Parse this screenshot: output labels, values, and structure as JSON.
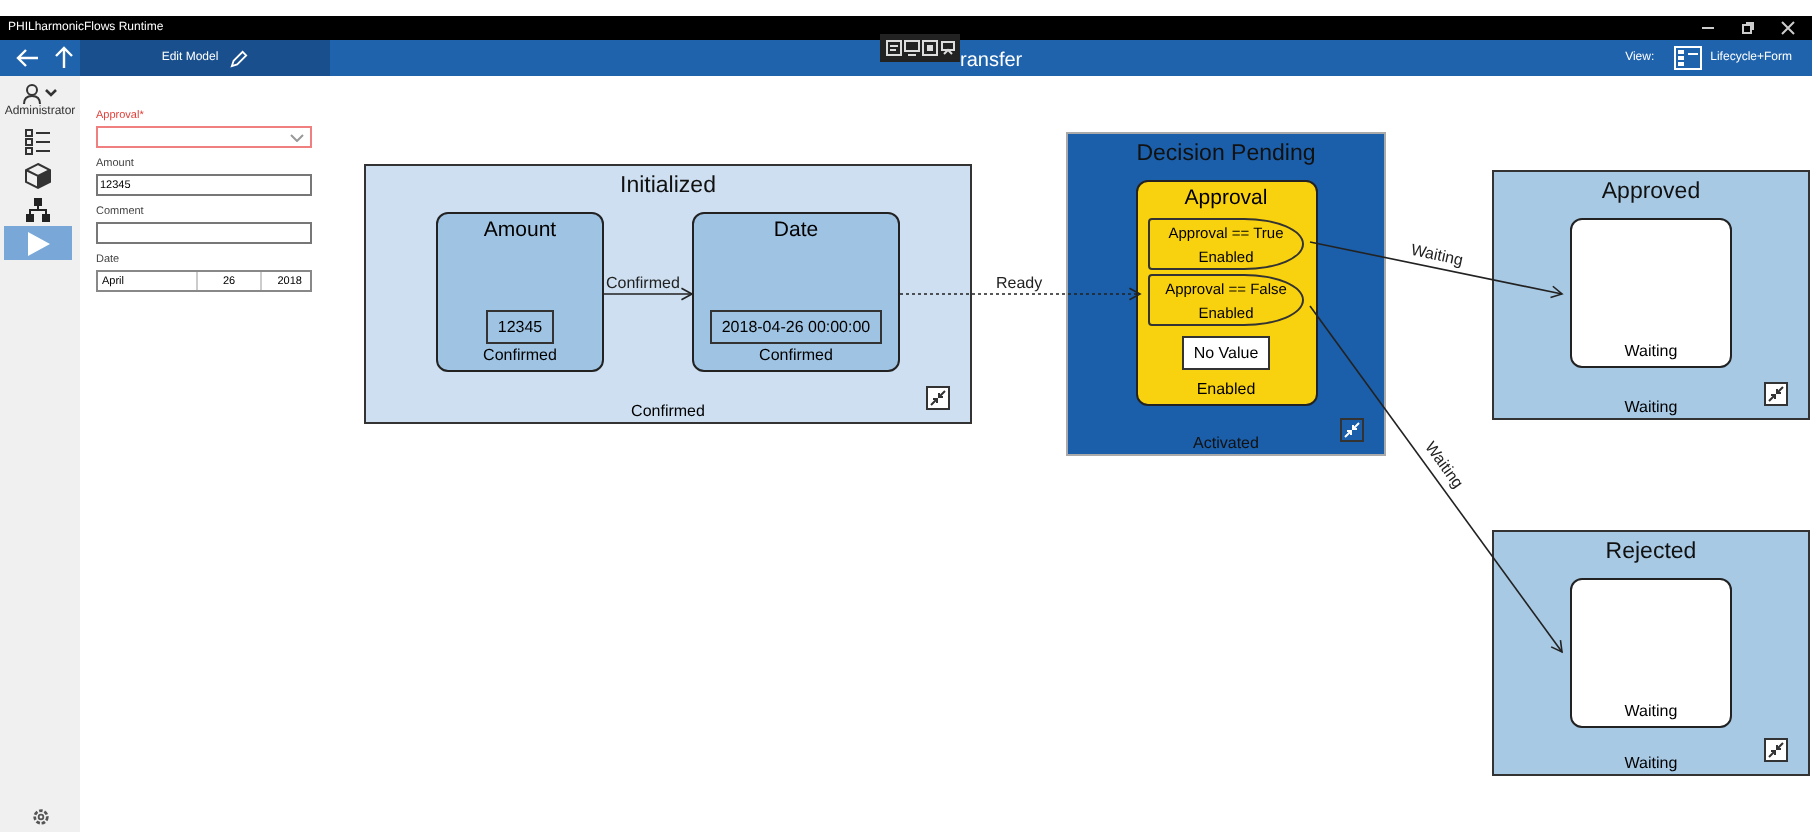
{
  "window": {
    "title": "PHILharmonicFlows Runtime"
  },
  "header": {
    "mode_button": "Edit Model",
    "title": "ransfer",
    "view_label": "View:",
    "view_value": "Lifecycle+Form"
  },
  "rail": {
    "user": "Administrator",
    "items": [
      {
        "kind": "list",
        "selected": false
      },
      {
        "kind": "cube",
        "selected": false
      },
      {
        "kind": "tree",
        "selected": false
      },
      {
        "kind": "play",
        "selected": true
      }
    ]
  },
  "form": {
    "fields": [
      {
        "label": "Approval*",
        "kind": "dropdown",
        "required": true
      },
      {
        "label": "Amount",
        "kind": "text",
        "value": "12345",
        "required": false
      },
      {
        "label": "Comment",
        "kind": "text",
        "required": false
      },
      {
        "label": "Date",
        "kind": "date",
        "parts": [
          "April",
          "26",
          "2018"
        ],
        "required": false
      }
    ]
  },
  "diagram": {
    "states": [
      {
        "title": "Initialized",
        "kind": "done",
        "status": "Confirmed",
        "steps": [
          {
            "kind": "attribute",
            "title": "Amount",
            "value": "12345",
            "status": "Confirmed"
          },
          {
            "kind": "attribute",
            "title": "Date",
            "value": "2018-04-26 00:00:00",
            "status": "Confirmed"
          }
        ]
      },
      {
        "title": "Decision Pending",
        "kind": "active",
        "status": "Activated",
        "steps": [
          {
            "kind": "decision",
            "title": "Approval",
            "conditions": [
              {
                "label": "Approval == True",
                "status": "Enabled"
              },
              {
                "label": "Approval == False",
                "status": "Enabled"
              }
            ],
            "value": "No Value",
            "status": "Enabled"
          }
        ]
      },
      {
        "title": "Approved",
        "kind": "waiting",
        "status": "Waiting",
        "steps": [
          {
            "kind": "empty",
            "status": "Waiting"
          }
        ]
      },
      {
        "title": "Rejected",
        "kind": "waiting",
        "status": "Waiting",
        "steps": [
          {
            "kind": "empty",
            "status": "Waiting"
          }
        ]
      }
    ],
    "transitions": [
      {
        "label": "Confirmed",
        "kind": "solid"
      },
      {
        "label": "Ready",
        "kind": "dotted"
      },
      {
        "label": "Waiting",
        "kind": "solid"
      },
      {
        "label": "Waiting",
        "kind": "solid"
      }
    ]
  }
}
